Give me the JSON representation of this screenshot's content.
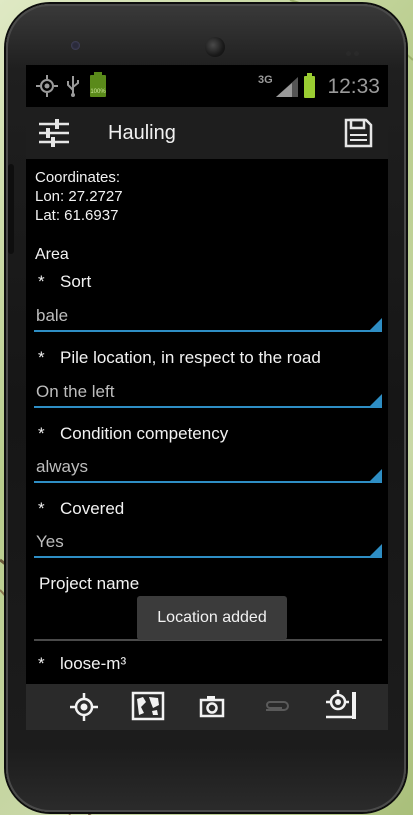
{
  "statusbar": {
    "battery_percent_label": "100%",
    "network_label": "3G",
    "time": "12:33"
  },
  "actionbar": {
    "title": "Hauling",
    "settings_icon": "sliders-icon",
    "save_icon": "floppy-disk-icon"
  },
  "form": {
    "coords_heading": "Coordinates:",
    "lon": "Lon: 27.2727",
    "lat": "Lat: 61.6937",
    "area_label": "Area",
    "required_mark": "*",
    "fields": [
      {
        "label": "Sort",
        "value": "bale"
      },
      {
        "label": "Pile location, in respect to the road",
        "value": "On the left"
      },
      {
        "label": "Condition competency",
        "value": "always"
      },
      {
        "label": "Covered",
        "value": "Yes"
      }
    ],
    "project_name_label": "Project name",
    "project_name_value": "",
    "loose_label": "loose-m³"
  },
  "toast": {
    "text": "Location added"
  },
  "bottombar": {
    "buttons": [
      "locate-icon",
      "map-icon",
      "camera-icon",
      "attachment-icon",
      "measure-location-icon"
    ]
  },
  "colors": {
    "accent": "#2e8ec4",
    "battery": "#9acd32",
    "screen_bg": "#000000",
    "actionbar_bg": "#1e1e1e"
  }
}
